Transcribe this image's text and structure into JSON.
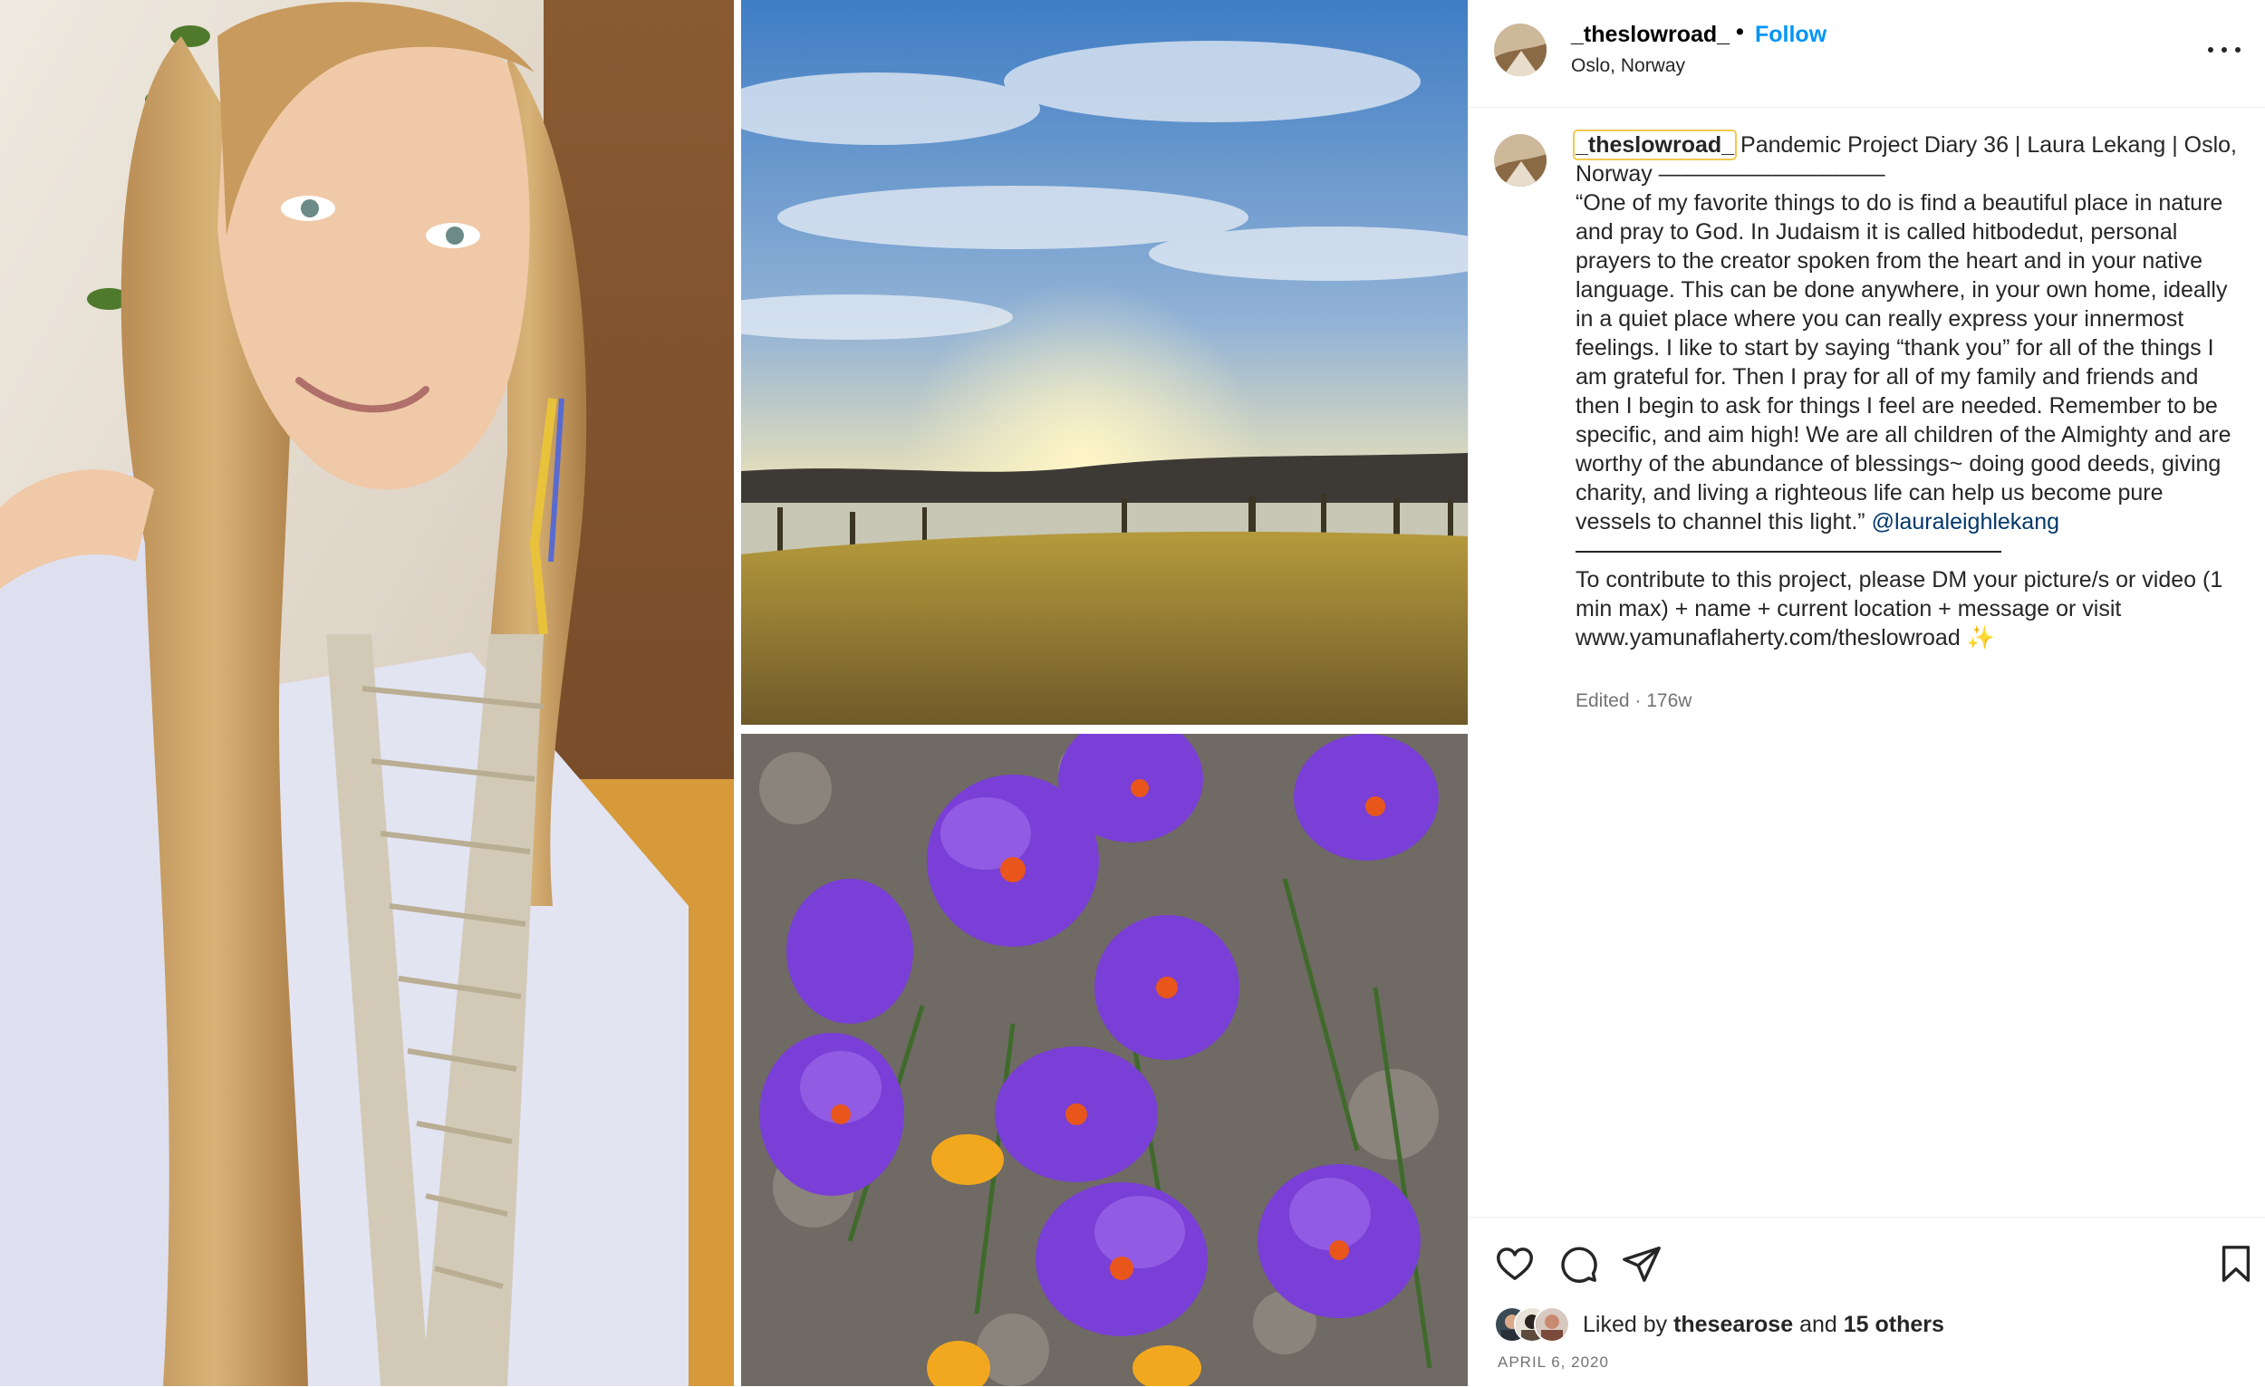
{
  "media": {
    "photos": [
      {
        "subject": "woman selfie with long blonde hair and striped scarf"
      },
      {
        "subject": "sunset over lake and field"
      },
      {
        "subject": "purple crocus flowers"
      }
    ]
  },
  "header": {
    "username": "_theslowroad_",
    "separator": "•",
    "follow_label": "Follow",
    "location": "Oslo, Norway",
    "more_icon": "more-horizontal-icon"
  },
  "caption": {
    "username": "_theslowroad_",
    "title": "Pandemic Project Diary 36 | Laura Lekang | Oslo, Norway ——————————",
    "quote": "“One of my favorite things to do is find a beautiful place in nature and pray to God. In Judaism it is called hitbodedut, personal prayers to the creator spoken from the heart and in your native language. This can be done anywhere, in your own home, ideally in a quiet place where you can really express your innermost feelings. I like to start by saying “thank you” for all of the things I am grateful for. Then I pray for all of my family and friends and then I begin to ask for things I feel are needed. Remember to be specific, and aim high! We are all children of the Almighty and are worthy of the abundance of blessings~ doing good deeds, giving charity, and living a righteous life can help us become pure vessels to channel this light.”",
    "mention": "@lauraleighlekang",
    "contribute": "To contribute to this project, please DM your picture/s or video (1 min max) + name + current location + message or visit www.yamunaflaherty.com/theslowroad",
    "sparkle": "✨",
    "edited": "Edited · 176w"
  },
  "actions": {
    "icons": [
      "heart-icon",
      "comment-icon",
      "share-icon",
      "bookmark-icon"
    ],
    "liked_prefix": "Liked by",
    "liked_user": "thesearose",
    "liked_and": "and",
    "liked_others": "15 others",
    "date": "APRIL 6, 2020"
  },
  "colors": {
    "link_blue": "#0095f6",
    "mention_blue": "#00376b",
    "text": "#262626",
    "muted": "#737373",
    "divider": "#efefef"
  }
}
